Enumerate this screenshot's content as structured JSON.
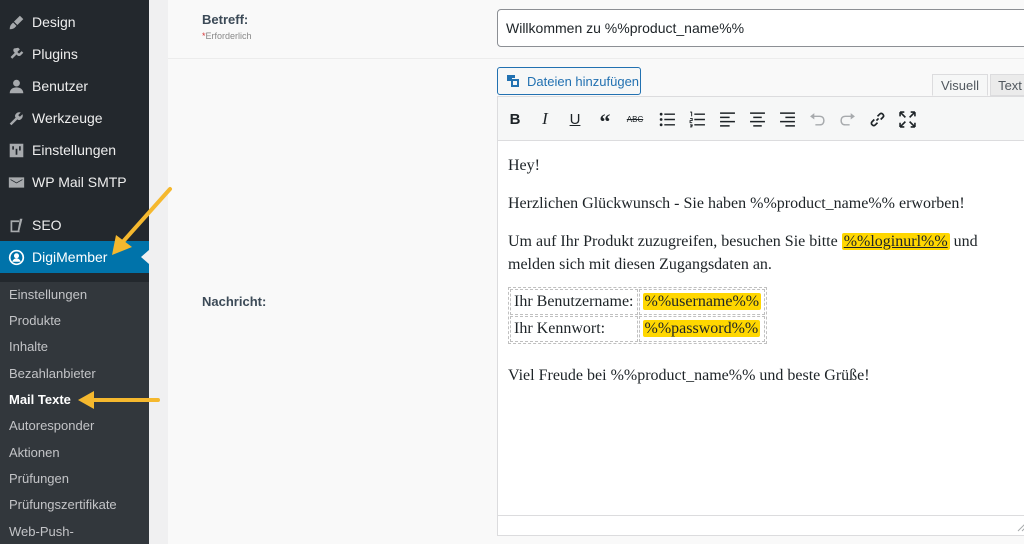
{
  "sidebar": {
    "items": [
      {
        "label": "Design",
        "icon": "brush-icon"
      },
      {
        "label": "Plugins",
        "icon": "plugin-icon"
      },
      {
        "label": "Benutzer",
        "icon": "user-icon"
      },
      {
        "label": "Werkzeuge",
        "icon": "wrench-icon"
      },
      {
        "label": "Einstellungen",
        "icon": "settings-icon"
      },
      {
        "label": "WP Mail SMTP",
        "icon": "mail-icon"
      },
      {
        "label": "SEO",
        "icon": "yoast-icon"
      },
      {
        "label": "DigiMember",
        "icon": "digimember-icon",
        "active": true
      }
    ],
    "submenu": [
      "Einstellungen",
      "Produkte",
      "Inhalte",
      "Bezahlanbieter",
      "Mail Texte",
      "Autoresponder",
      "Aktionen",
      "Prüfungen",
      "Prüfungszertifikate",
      "Web-Push-"
    ],
    "submenu_current": "Mail Texte",
    "colors": {
      "bg": "#23282d",
      "active": "#0073aa",
      "submenu_bg": "#32373c"
    }
  },
  "form": {
    "subject_label": "Betreff:",
    "required_star": "*",
    "required_text": "Erforderlich",
    "subject_value": "Willkommen zu %%product_name%%",
    "message_label": "Nachricht:",
    "add_media_label": "Dateien hinzufügen",
    "tab_visual": "Visuell",
    "tab_text": "Text"
  },
  "toolbar": {
    "buttons": [
      "bold-icon",
      "italic-icon",
      "underline-icon",
      "blockquote-icon",
      "strikethrough-icon",
      "bullet-list-icon",
      "numbered-list-icon",
      "align-left-icon",
      "align-center-icon",
      "align-right-icon",
      "undo-icon",
      "redo-icon",
      "link-icon",
      "fullscreen-icon"
    ],
    "strike_text": "ABC"
  },
  "message": {
    "greeting": "Hey!",
    "line2": "Herzlichen Glückwunsch - Sie haben %%product_name%% erworben!",
    "line3_before": "Um auf Ihr Produkt zuzugreifen, besuchen Sie bitte",
    "line3_link": "%%loginurl%%",
    "line3_after": "und",
    "line4": "melden sich mit diesen Zugangsdaten an.",
    "table": [
      {
        "label": "Ihr Benutzername:",
        "value": "%%username%%"
      },
      {
        "label": "Ihr Kennwort:",
        "value": "%%password%%"
      }
    ],
    "closing": "Viel Freude bei %%product_name%% und beste Grüße!"
  },
  "colors": {
    "highlight": "#ffd700",
    "arrow": "#f5b82e",
    "link": "#2271b1"
  }
}
